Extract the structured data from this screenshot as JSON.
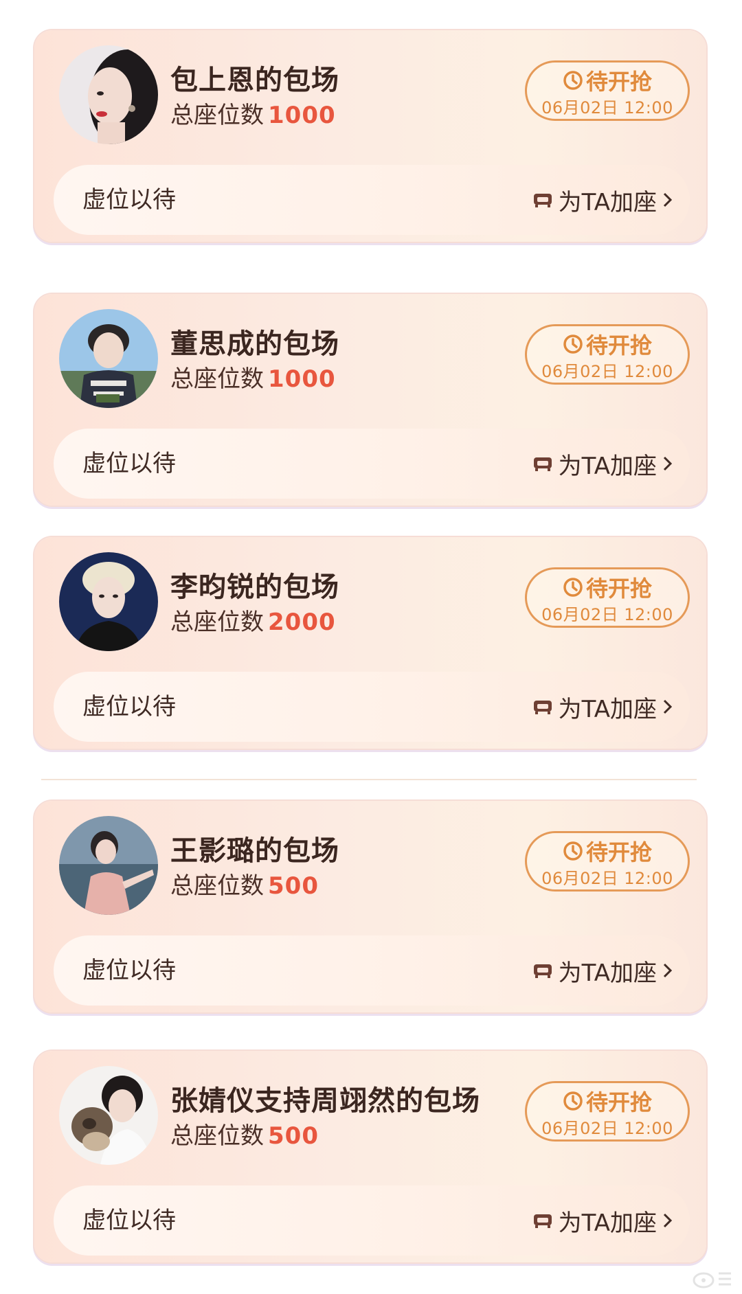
{
  "cards": [
    {
      "title": "包上恩的包场",
      "seats_label": "总座位数",
      "seats": "1000",
      "status": "待开抢",
      "time": "06月02日 12:00",
      "bar_left": "虚位以待",
      "bar_action": "为TA加座"
    },
    {
      "title": "董思成的包场",
      "seats_label": "总座位数",
      "seats": "1000",
      "status": "待开抢",
      "time": "06月02日 12:00",
      "bar_left": "虚位以待",
      "bar_action": "为TA加座"
    },
    {
      "title": "李昀锐的包场",
      "seats_label": "总座位数",
      "seats": "2000",
      "status": "待开抢",
      "time": "06月02日 12:00",
      "bar_left": "虚位以待",
      "bar_action": "为TA加座"
    },
    {
      "title": "王影璐的包场",
      "seats_label": "总座位数",
      "seats": "500",
      "status": "待开抢",
      "time": "06月02日 12:00",
      "bar_left": "虚位以待",
      "bar_action": "为TA加座"
    },
    {
      "title": "张婧仪支持周翊然的包场",
      "seats_label": "总座位数",
      "seats": "500",
      "status": "待开抢",
      "time": "06月02日 12:00",
      "bar_left": "虚位以待",
      "bar_action": "为TA加座"
    }
  ],
  "icons": {
    "status": "clock-icon",
    "seat": "sofa-icon",
    "chevron": "chevron-right-icon",
    "avatar": "avatar-photo"
  },
  "colors": {
    "accent_orange": "#e08a3c",
    "seat_count_red": "#e8563e",
    "text_dark": "#3b2620",
    "card_bg": "#fde3d8"
  }
}
